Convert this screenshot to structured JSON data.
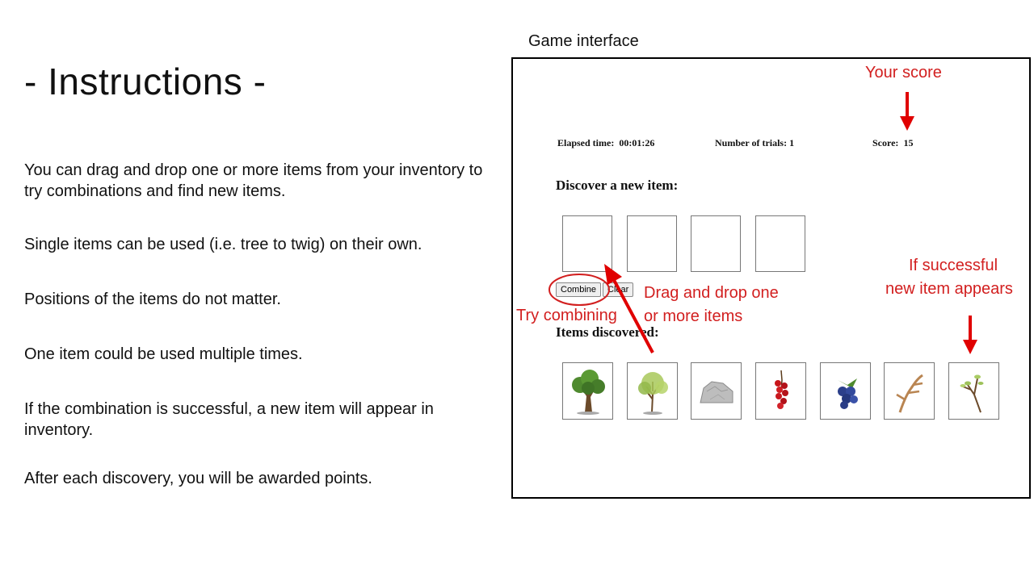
{
  "slide": {
    "title": "- Instructions -",
    "instructions": [
      "You can drag and drop one or more items from your inventory to try combinations and find new items.",
      "Single items can be used (i.e. tree to twig) on their own.",
      "Positions of the items do not matter.",
      "One item could be used multiple times.",
      "If the combination is successful, a new item will appear in inventory.",
      "After each discovery, you will be awarded points."
    ],
    "panel_caption": "Game interface"
  },
  "game": {
    "elapsed_label": "Elapsed time:",
    "elapsed_value": "00:01:26",
    "trials_label": "Number of trials:",
    "trials_value": "1",
    "score_label": "Score:",
    "score_value": "15",
    "discover_heading": "Discover a new item:",
    "combine_label": "Combine",
    "clear_label": "Clear",
    "discovered_heading": "Items discovered:",
    "items": [
      "tree-icon",
      "leafy-tree-icon",
      "rock-icon",
      "red-berries-icon",
      "blueberries-icon",
      "antler-icon",
      "twig-icon"
    ]
  },
  "annotations": {
    "score": "Your score",
    "success_line1": "If successful",
    "success_line2": "new item appears",
    "drag_line1": "Drag and drop one",
    "drag_line2": "or more items",
    "combine": "Try combining",
    "color": "#d21f1f"
  }
}
